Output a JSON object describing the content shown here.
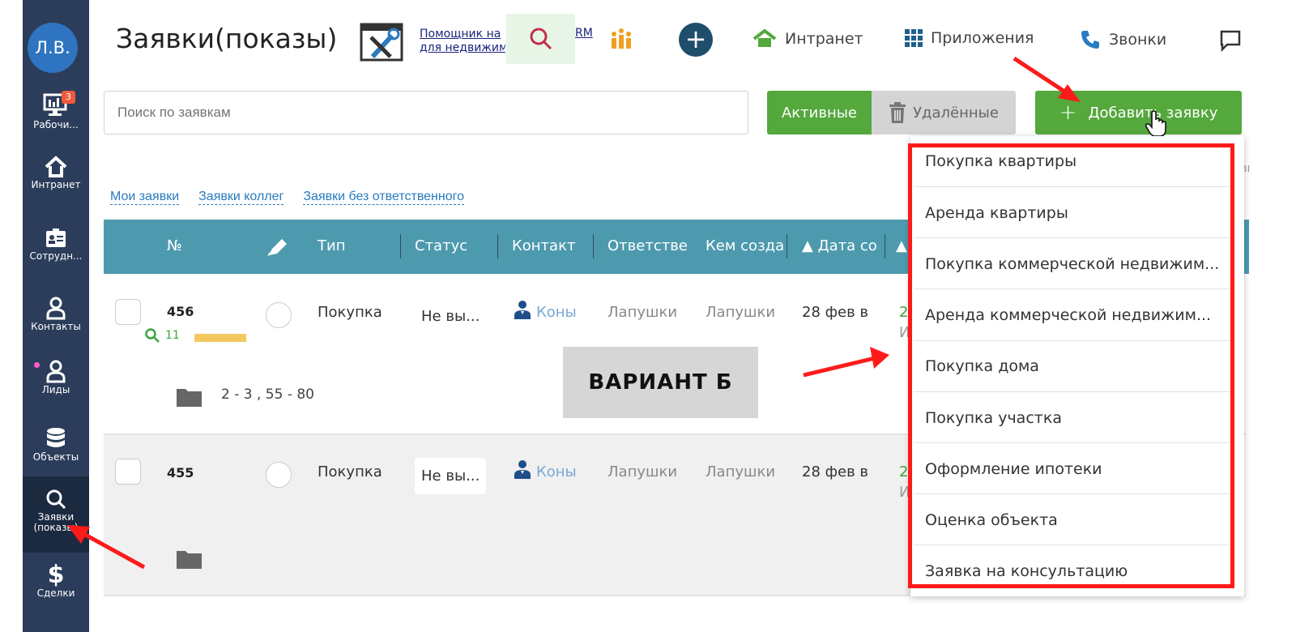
{
  "sidebar": {
    "avatar": "Л.В.",
    "items": [
      {
        "label": "Рабочи...",
        "icon": "desktop-icon",
        "badge": "3"
      },
      {
        "label": "Интранет",
        "icon": "home-icon"
      },
      {
        "label": "Сотрудн...",
        "icon": "id-card-icon"
      },
      {
        "label": "Контакты",
        "icon": "person-icon"
      },
      {
        "label": "Лиды",
        "icon": "person-icon"
      },
      {
        "label": "Объекты",
        "icon": "database-icon"
      },
      {
        "label": "Заявки (показы)",
        "icon": "search-icon"
      },
      {
        "label": "Сделки",
        "icon": "dollar-icon"
      }
    ]
  },
  "header": {
    "title": "Заявки(показы)",
    "helper_line1": "Помощник на",
    "helper_line2": "для недвижим",
    "crm_suffix": "RM",
    "nav": [
      {
        "label": "Интранет",
        "icon": "home-icon"
      },
      {
        "label": "Приложения",
        "icon": "grid-icon"
      },
      {
        "label": "Звонки",
        "icon": "phone-icon"
      }
    ]
  },
  "toolbar": {
    "search_placeholder": "Поиск по заявкам",
    "active_label": "Активные",
    "deleted_label": "Удалённые",
    "add_label": "Добавить заявку"
  },
  "filters": [
    "Мои заявки",
    "Заявки коллег",
    "Заявки без ответственного"
  ],
  "table": {
    "columns": [
      "№",
      "Тип",
      "Статус",
      "Контакт",
      "Ответстве",
      "Кем созда",
      "▲ Дата со",
      "▲"
    ],
    "rows": [
      {
        "num": "456",
        "matches": "11",
        "type": "Покупка",
        "status": "Не вы...",
        "contact": "Коны",
        "responsible": "Лапушки",
        "creator": "Лапушки",
        "date": "28 фев в",
        "extra1": "2",
        "extra2": "И",
        "folder": "2 - 3 , 55 - 80"
      },
      {
        "num": "455",
        "type": "Покупка",
        "status": "Не вы...",
        "contact": "Коны",
        "responsible": "Лапушки",
        "creator": "Лапушки",
        "date": "28 фев в",
        "extra1": "2",
        "extra2": "И",
        "folder": ""
      }
    ]
  },
  "variant_label": "ВАРИАНТ Б",
  "dropdown": {
    "items": [
      "Покупка квартиры",
      "Аренда квартиры",
      "Покупка коммерческой недвижим...",
      "Аренда коммерческой недвижим...",
      "Покупка дома",
      "Покупка участка",
      "Оформление ипотеки",
      "Оценка объекта",
      "Заявка на консультацию"
    ]
  },
  "right_fragment": "зı",
  "colors": {
    "sidebar": "#2b3d5a",
    "green": "#54a83c",
    "teal_header": "#4d9aae",
    "annotation_red": "#ff1a1a"
  }
}
